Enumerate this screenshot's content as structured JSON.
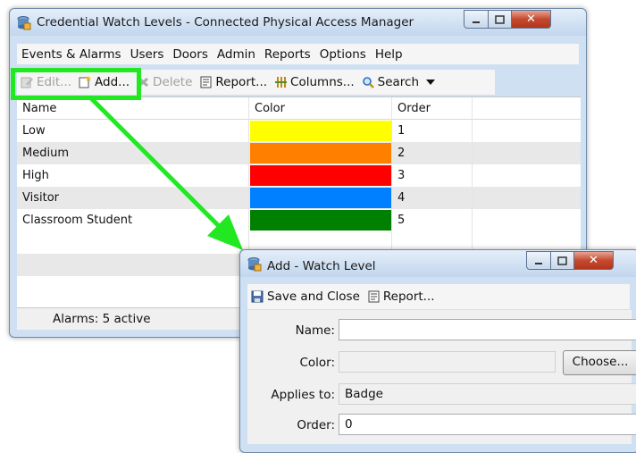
{
  "main_window": {
    "title": "Credential Watch Levels - Connected Physical Access Manager",
    "menu": [
      "Events & Alarms",
      "Users",
      "Doors",
      "Admin",
      "Reports",
      "Options",
      "Help"
    ],
    "toolbar": {
      "edit_label": "Edit...",
      "add_label": "Add...",
      "delete_label": "Delete",
      "report_label": "Report...",
      "columns_label": "Columns...",
      "search_label": "Search"
    },
    "table": {
      "headers": [
        "Name",
        "Color",
        "Order"
      ],
      "rows": [
        {
          "name": "Low",
          "color": "#ffff00",
          "order": "1"
        },
        {
          "name": "Medium",
          "color": "#ff8000",
          "order": "2"
        },
        {
          "name": "High",
          "color": "#ff0000",
          "order": "3"
        },
        {
          "name": "Visitor",
          "color": "#0080ff",
          "order": "4"
        },
        {
          "name": "Classroom Student",
          "color": "#008000",
          "order": "5"
        }
      ]
    },
    "status": "Alarms: 5 active"
  },
  "dialog": {
    "title": "Add - Watch Level",
    "toolbar": {
      "save_label": "Save and Close",
      "report_label": "Report..."
    },
    "fields": {
      "name_label": "Name:",
      "name_value": "",
      "color_label": "Color:",
      "choose_label": "Choose...",
      "applies_label": "Applies to:",
      "applies_value": "Badge",
      "order_label": "Order:",
      "order_value": "0"
    }
  },
  "accent_colors": {
    "highlight": "#22e822",
    "arrow": "#22e822"
  }
}
